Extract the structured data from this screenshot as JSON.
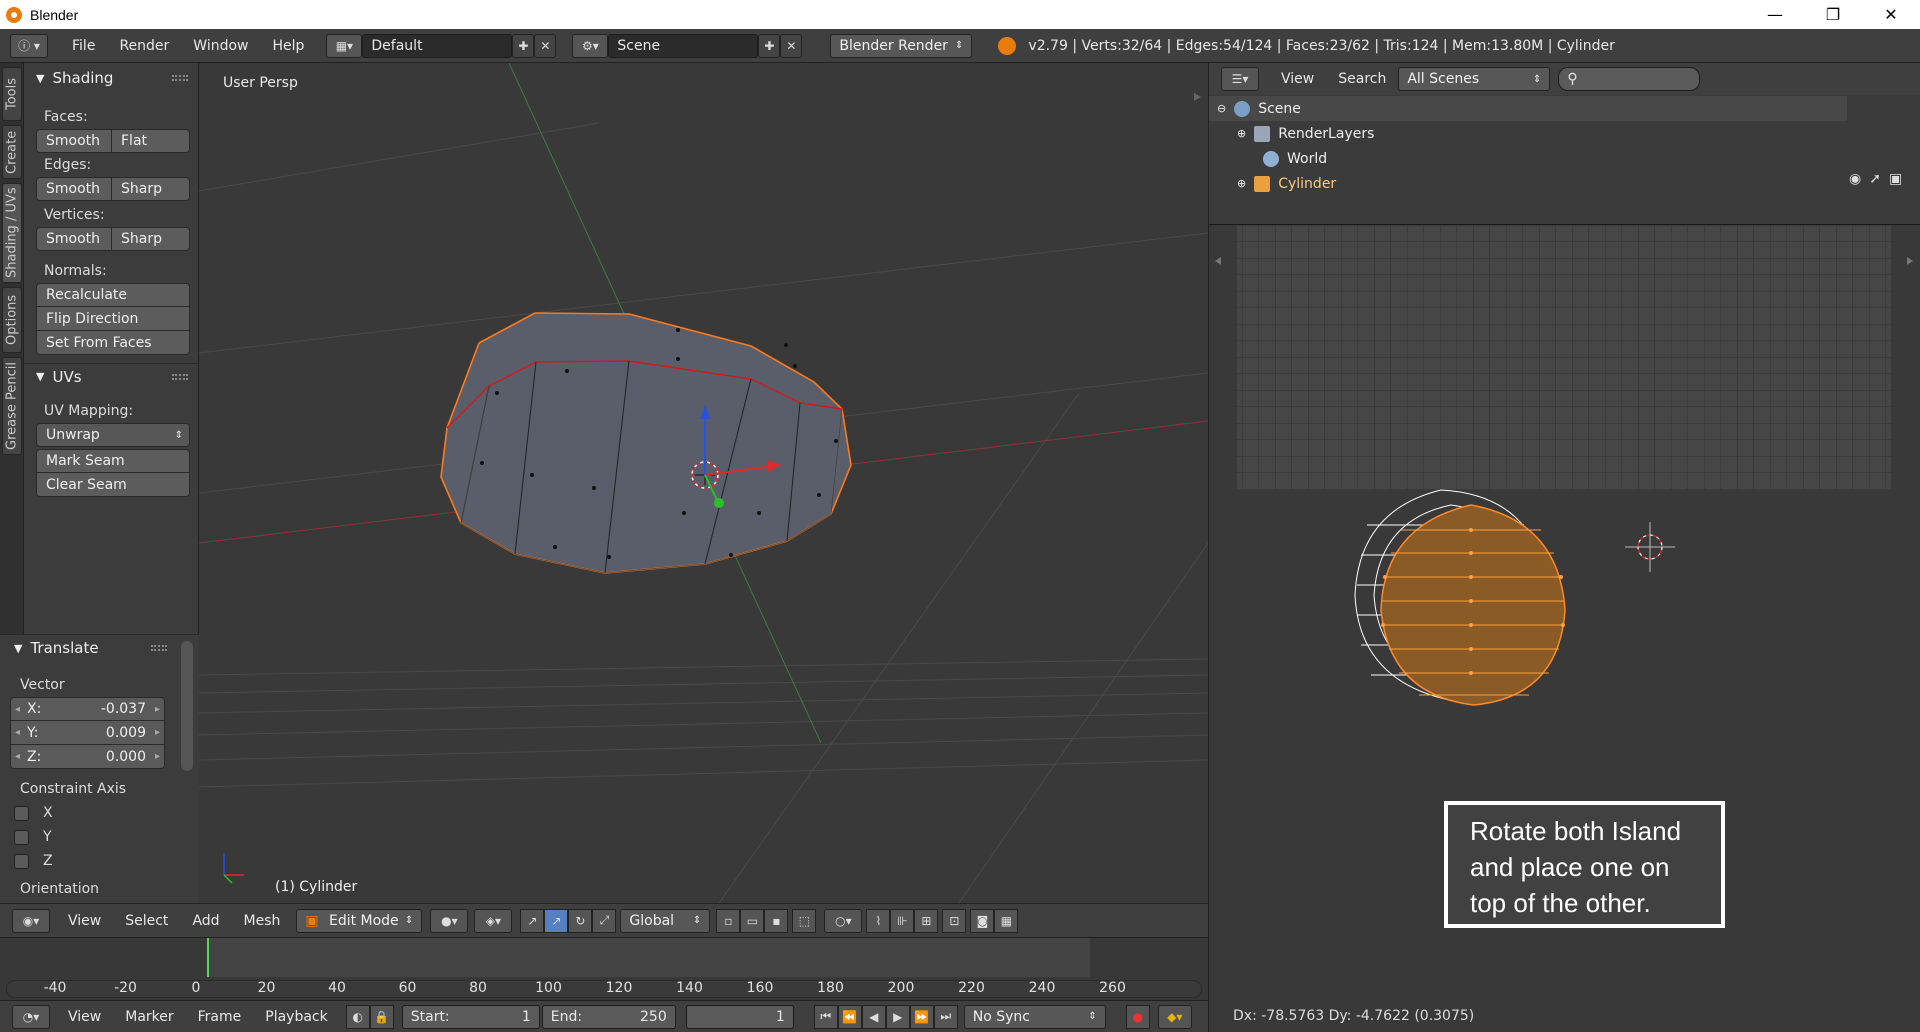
{
  "window": {
    "title": "Blender",
    "minimize": "—",
    "maximize": "❐",
    "close": "✕"
  },
  "topbar": {
    "menus": [
      "File",
      "Render",
      "Window",
      "Help"
    ],
    "screen_layout": "Default",
    "scene": "Scene",
    "render_engine": "Blender Render",
    "stats": "v2.79 | Verts:32/64 | Edges:54/124 | Faces:23/62 | Tris:124 | Mem:13.80M | Cylinder"
  },
  "tool_tabs": [
    "Tools",
    "Create",
    "Shading / UVs",
    "Options",
    "Grease Pencil"
  ],
  "shading_panel": {
    "title": "Shading",
    "faces_label": "Faces:",
    "faces_buttons": [
      "Smooth",
      "Flat"
    ],
    "edges_label": "Edges:",
    "edges_buttons": [
      "Smooth",
      "Sharp"
    ],
    "vertices_label": "Vertices:",
    "vertices_buttons": [
      "Smooth",
      "Sharp"
    ],
    "normals_label": "Normals:",
    "normals_buttons": [
      "Recalculate",
      "Flip Direction",
      "Set From Faces"
    ]
  },
  "uvs_panel": {
    "title": "UVs",
    "mapping_label": "UV Mapping:",
    "unwrap": "Unwrap",
    "mark_seam": "Mark Seam",
    "clear_seam": "Clear Seam"
  },
  "translate_panel": {
    "title": "Translate",
    "vector_label": "Vector",
    "x_label": "X:",
    "x_value": "-0.037",
    "y_label": "Y:",
    "y_value": "0.009",
    "z_label": "Z:",
    "z_value": "0.000",
    "constraint_label": "Constraint Axis",
    "axes": [
      "X",
      "Y",
      "Z"
    ],
    "orientation_label": "Orientation"
  },
  "viewport": {
    "view_name": "User Persp",
    "object_label": "(1) Cylinder"
  },
  "viewport_header": {
    "menus": [
      "View",
      "Select",
      "Add",
      "Mesh"
    ],
    "mode": "Edit Mode",
    "orientation": "Global"
  },
  "timeline": {
    "ticks": [
      "-40",
      "-20",
      "0",
      "20",
      "40",
      "60",
      "80",
      "100",
      "120",
      "140",
      "160",
      "180",
      "200",
      "220",
      "240",
      "260"
    ],
    "menus": [
      "View",
      "Marker",
      "Frame",
      "Playback"
    ],
    "start_label": "Start:",
    "start_value": "1",
    "end_label": "End:",
    "end_value": "250",
    "current_frame": "1",
    "sync": "No Sync"
  },
  "outliner": {
    "menus": [
      "View",
      "Search"
    ],
    "filter": "All Scenes",
    "items": [
      "Scene",
      "RenderLayers",
      "World",
      "Cylinder"
    ]
  },
  "uv_editor": {
    "status": "Dx: -78.5763  Dy: -4.7622 (0.3075)"
  },
  "caption": "Rotate both Island and place one on top of the other."
}
